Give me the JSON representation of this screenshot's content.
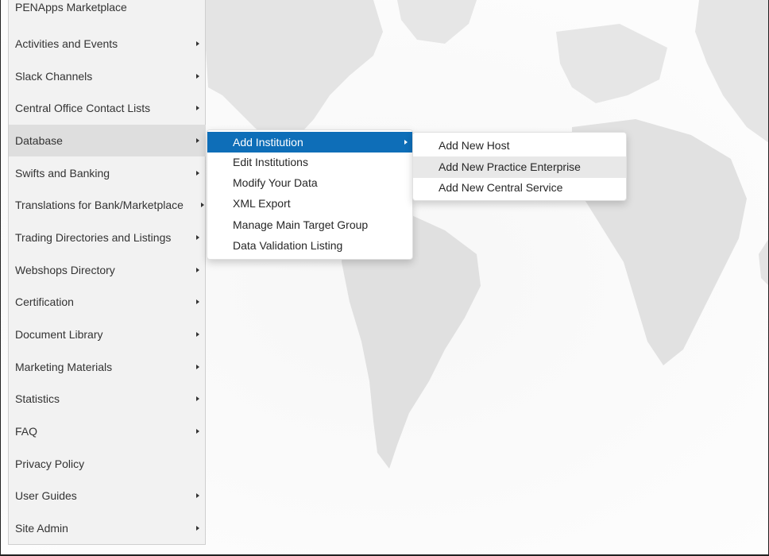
{
  "main_menu": {
    "items": [
      {
        "label": "PENApps Marketplace",
        "has_submenu": false
      },
      {
        "label": "Activities and Events",
        "has_submenu": true
      },
      {
        "label": "Slack Channels",
        "has_submenu": true
      },
      {
        "label": "Central Office Contact Lists",
        "has_submenu": true
      },
      {
        "label": "Database",
        "has_submenu": true,
        "active": true
      },
      {
        "label": "Swifts and Banking",
        "has_submenu": true
      },
      {
        "label": "Translations for Bank/Marketplace",
        "has_submenu": true
      },
      {
        "label": "Trading Directories and Listings",
        "has_submenu": true
      },
      {
        "label": "Webshops Directory",
        "has_submenu": true
      },
      {
        "label": "Certification",
        "has_submenu": true
      },
      {
        "label": "Document Library",
        "has_submenu": true
      },
      {
        "label": "Marketing Materials",
        "has_submenu": true
      },
      {
        "label": "Statistics",
        "has_submenu": true
      },
      {
        "label": "FAQ",
        "has_submenu": true
      },
      {
        "label": "Privacy Policy",
        "has_submenu": false
      },
      {
        "label": "User Guides",
        "has_submenu": true
      },
      {
        "label": "Site Admin",
        "has_submenu": true
      }
    ]
  },
  "database_submenu": {
    "items": [
      {
        "label": "Add Institution",
        "has_submenu": true,
        "active": true
      },
      {
        "label": "Edit Institutions"
      },
      {
        "label": "Modify Your Data"
      },
      {
        "label": "XML Export"
      },
      {
        "label": "Manage Main Target Group"
      },
      {
        "label": "Data Validation Listing"
      }
    ]
  },
  "add_institution_submenu": {
    "items": [
      {
        "label": "Add New Host"
      },
      {
        "label": "Add New Practice Enterprise",
        "hovered": true
      },
      {
        "label": "Add New Central Service"
      }
    ]
  },
  "colors": {
    "menu_background": "#f2f2f2",
    "menu_active": "#dedede",
    "submenu_active": "#0e6eb8",
    "submenu_hover": "#e8e8e8",
    "map_land": "#e2e2e2"
  },
  "icons": {
    "submenu_indicator": "caret-right-icon",
    "background": "world-map-image"
  }
}
